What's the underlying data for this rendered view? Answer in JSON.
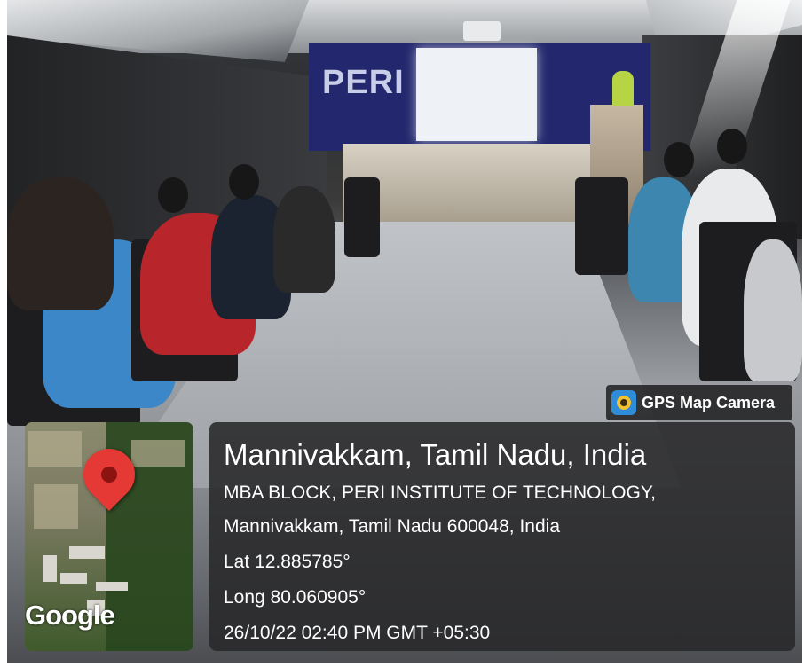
{
  "scene": {
    "banner_text": "PERI"
  },
  "badge": {
    "label": "GPS Map Camera",
    "icon": "gps-map-camera-app-icon"
  },
  "map": {
    "attribution": "Google",
    "pin_icon": "location-pin-icon"
  },
  "location": {
    "title": "Mannivakkam, Tamil Nadu, India",
    "address_line1": "MBA BLOCK, PERI INSTITUTE OF TECHNOLOGY,",
    "address_line2": "Mannivakkam, Tamil Nadu 600048, India",
    "latitude": "Lat 12.885785°",
    "longitude": "Long 80.060905°",
    "timestamp": "26/10/22 02:40 PM GMT +05:30"
  },
  "colors": {
    "pin": "#e53935",
    "panel": "#28282a",
    "banner": "#23286e",
    "speaker_vest": "#b7d445"
  }
}
